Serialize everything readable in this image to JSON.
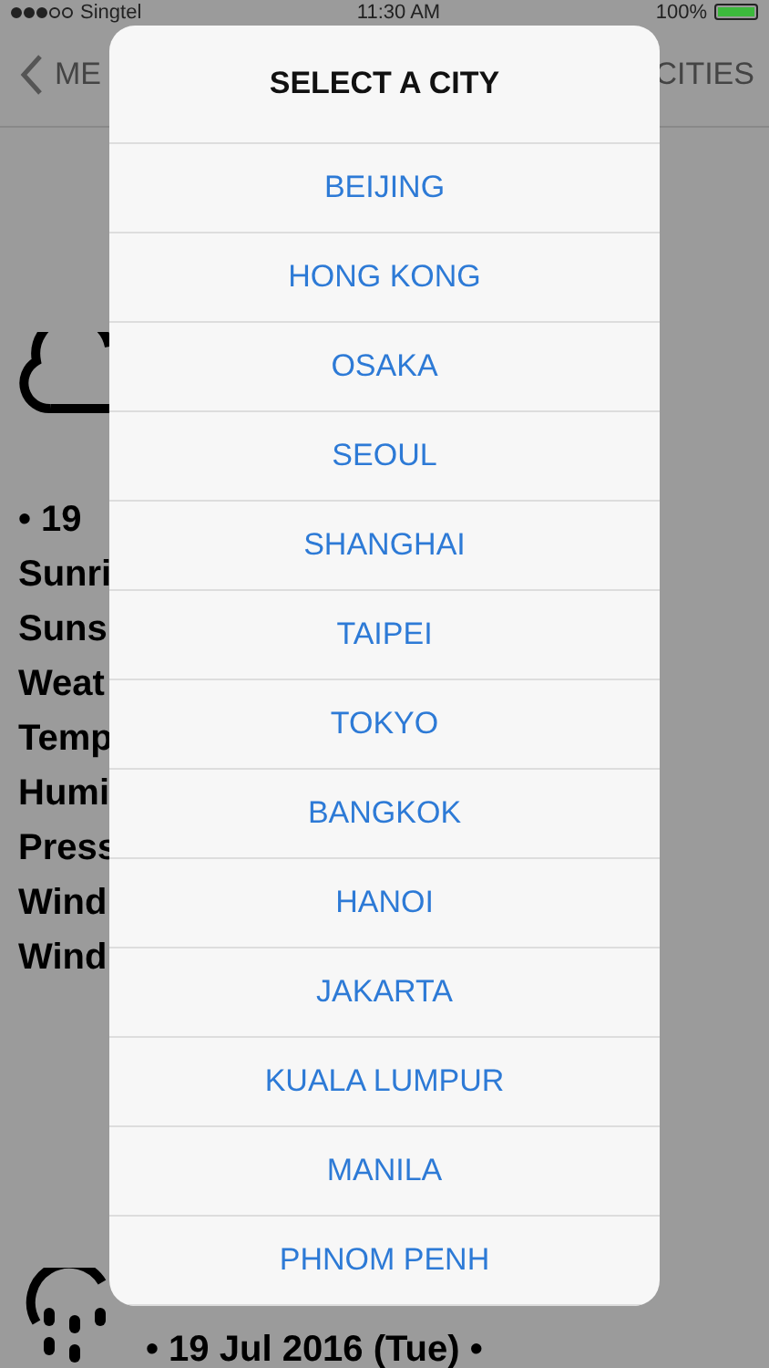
{
  "status_bar": {
    "signal_dots": [
      {
        "filled": true
      },
      {
        "filled": true
      },
      {
        "filled": true
      },
      {
        "filled": false
      },
      {
        "filled": false
      }
    ],
    "carrier": "Singtel",
    "time": "11:30 AM",
    "battery": "100%"
  },
  "nav": {
    "back": "ME",
    "right": "CITIES"
  },
  "background": {
    "date": "• 19",
    "labels": [
      "Sunri",
      "Suns",
      "Weat",
      "Temp",
      "Humi",
      "Press",
      "Wind",
      "Wind"
    ],
    "next_date": "• 19 Jul 2016 (Tue) •"
  },
  "dialog": {
    "title": "SELECT A CITY",
    "cities": [
      "BEIJING",
      "HONG KONG",
      "OSAKA",
      "SEOUL",
      "SHANGHAI",
      "TAIPEI",
      "TOKYO",
      "BANGKOK",
      "HANOI",
      "JAKARTA",
      "KUALA LUMPUR",
      "MANILA",
      "PHNOM PENH"
    ]
  }
}
